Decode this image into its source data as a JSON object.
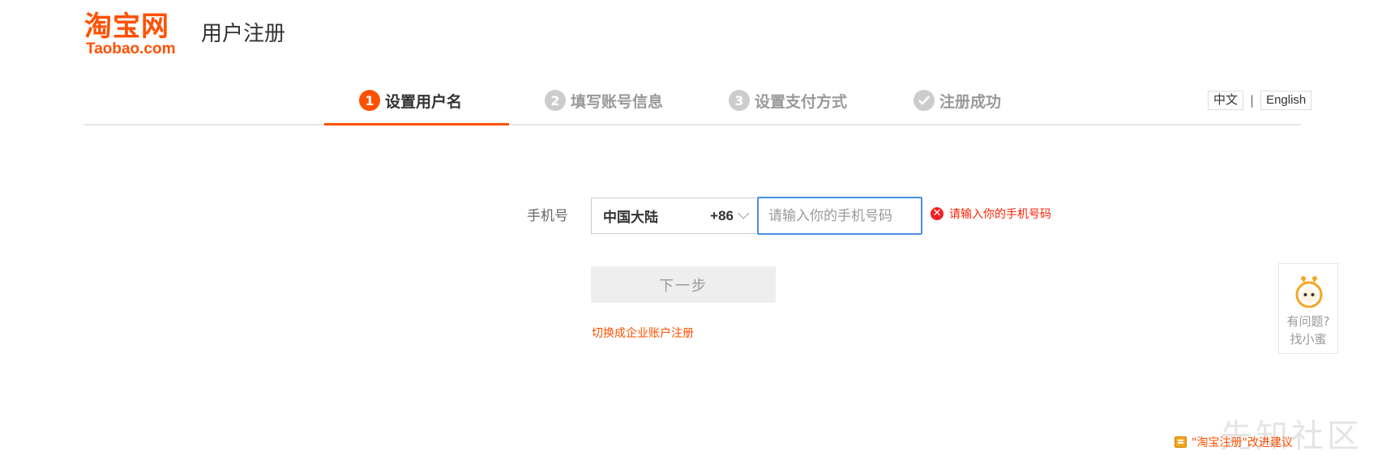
{
  "header": {
    "logo_cn": "淘宝网",
    "logo_en": "Taobao.com",
    "title": "用户注册"
  },
  "steps": [
    {
      "num": "1",
      "label": "设置用户名",
      "active": true
    },
    {
      "num": "2",
      "label": "填写账号信息",
      "active": false
    },
    {
      "num": "3",
      "label": "设置支付方式",
      "active": false
    },
    {
      "num": "",
      "label": "注册成功",
      "active": false
    }
  ],
  "language": {
    "chinese": "中文",
    "separator": "|",
    "english": "English"
  },
  "form": {
    "phone_label": "手机号",
    "region_name": "中国大陆",
    "region_code": "+86",
    "phone_value": "",
    "phone_placeholder": "请输入你的手机号码",
    "error_icon": "✕",
    "error_text": "请输入你的手机号码",
    "next_button": "下一步",
    "switch_link": "切换成企业账户注册"
  },
  "help": {
    "line1": "有问题?",
    "line2": "找小蜜"
  },
  "feedback": {
    "text": "\"淘宝注册\"改进建议"
  },
  "watermark": "先知社区",
  "colors": {
    "brand": "#ff5000",
    "error": "#ff2200",
    "focus_border": "#4a90e2"
  }
}
